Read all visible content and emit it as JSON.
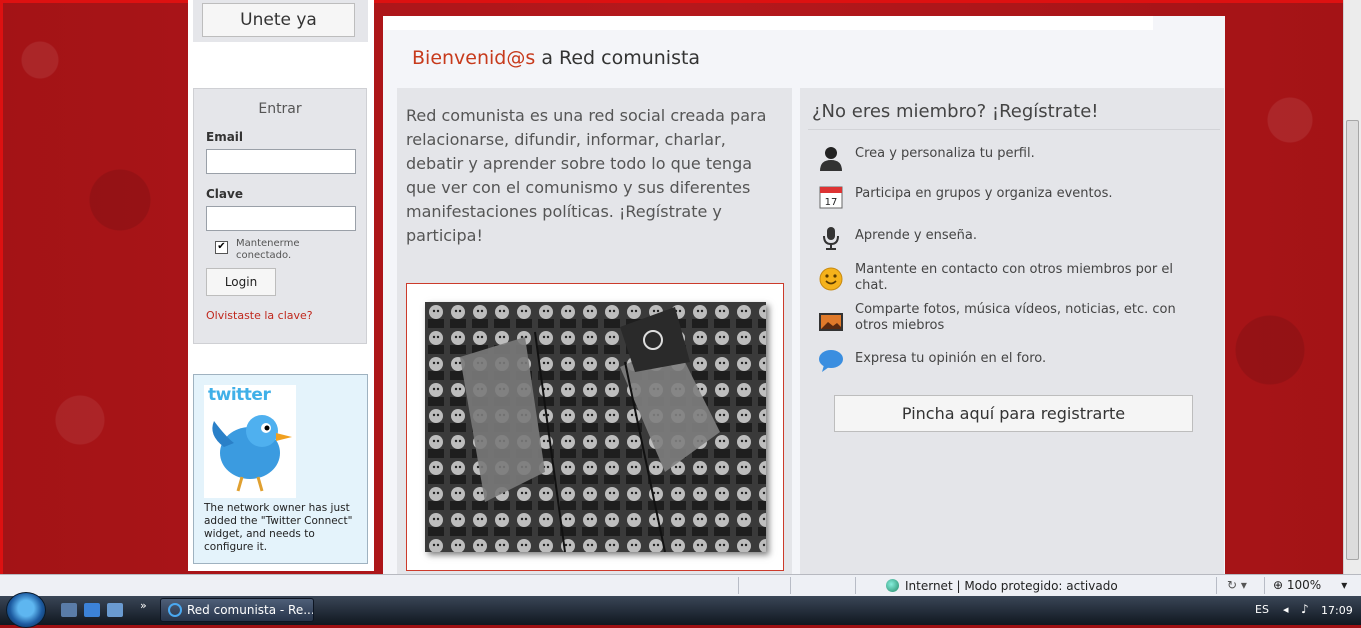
{
  "sidebar": {
    "join_label": "Unete ya",
    "login": {
      "title": "Entrar",
      "email_label": "Email",
      "email_value": "",
      "password_label": "Clave",
      "password_value": "",
      "remember_line1": "Mantenerme",
      "remember_line2": "conectado.",
      "remember_checked": true,
      "login_label": "Login",
      "forgot_label": "Olvistaste la clave?"
    },
    "twitter": {
      "logo_text": "twitter",
      "notice": "The network owner has just added the \"Twitter Connect\" widget, and needs to configure it."
    }
  },
  "main": {
    "welcome_prefix": "Bienvenid@s",
    "welcome_suffix": "a Red comunista",
    "intro": "Red comunista es una red social creada para relacionarse, difundir, informar, charlar, debatir y aprender sobre todo lo que tenga que ver con el comunismo y sus diferentes manifestaciones políticas. ¡Regístrate y participa!",
    "register_title": "¿No eres miembro? ¡Regístrate!",
    "features": [
      {
        "icon": "person-icon",
        "text": "Crea y personaliza tu perfil."
      },
      {
        "icon": "calendar-icon",
        "text": "Participa en grupos y organiza eventos.",
        "calendar_day": "17"
      },
      {
        "icon": "microphone-icon",
        "text": "Aprende y enseña."
      },
      {
        "icon": "smiley-icon",
        "text": "Mantente en contacto con otros miembros por el chat."
      },
      {
        "icon": "photo-icon",
        "text": "Comparte fotos, música vídeos, noticias, etc. con otros miebros"
      },
      {
        "icon": "speech-bubble-icon",
        "text": "Expresa tu opinión en el foro."
      }
    ],
    "register_button": "Pincha aquí para registrarte"
  },
  "statusbar": {
    "zone_text": "Internet | Modo protegido: activado",
    "zoom": "100%"
  },
  "taskbar": {
    "window_title": "Red comunista - Re...",
    "language": "ES",
    "time": "17:09"
  },
  "colors": {
    "accent_red": "#c73a1c",
    "background_red": "#a31316",
    "panel_gray": "#e4e5e9"
  }
}
